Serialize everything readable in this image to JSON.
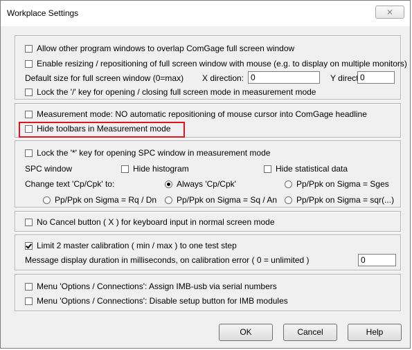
{
  "window": {
    "title": "Workplace Settings",
    "close_glyph": "⨯"
  },
  "group1": {
    "allow_overlap": {
      "label": "Allow other program windows to overlap ComGage full screen window",
      "checked": false
    },
    "enable_resizing": {
      "label": "Enable resizing / repositioning of full screen window with mouse (e.g. to display on multiple monitors)",
      "checked": false
    },
    "default_size_label": "Default size for full screen window (0=max)",
    "x_label": "X direction:",
    "x_value": "0",
    "y_label": "Y direction:",
    "y_value": "0",
    "lock_slash": {
      "label": "Lock the '/' key for opening / closing full screen mode in measurement mode",
      "checked": false
    }
  },
  "group2": {
    "no_reposition": {
      "label": "Measurement mode: NO automatic repositioning of mouse cursor into ComGage headline",
      "checked": false
    },
    "hide_toolbars": {
      "label": "Hide toolbars in Measurement mode",
      "checked": false
    }
  },
  "group3": {
    "lock_star": {
      "label": "Lock the '*' key for opening SPC window in measurement mode",
      "checked": false
    },
    "spc_window_label": "SPC window",
    "hide_histogram": {
      "label": "Hide histogram",
      "checked": false
    },
    "hide_statistical": {
      "label": "Hide statistical data",
      "checked": false
    },
    "change_text_label": "Change text 'Cp/Cpk' to:",
    "radios": [
      {
        "label": "Always 'Cp/Cpk'",
        "checked": true
      },
      {
        "label": "Pp/Ppk on Sigma = Sges",
        "checked": false
      },
      {
        "label": "Pp/Ppk on Sigma = Rq / Dn",
        "checked": false
      },
      {
        "label": "Pp/Ppk on Sigma = Sq / An",
        "checked": false
      },
      {
        "label": "Pp/Ppk on Sigma = sqr(...)",
        "checked": false
      }
    ]
  },
  "group4": {
    "no_cancel": {
      "label": "No Cancel button ( X ) for keyboard input in normal screen mode",
      "checked": false
    }
  },
  "group5": {
    "limit_master": {
      "label": "Limit 2 master calibration ( min / max ) to one test step",
      "checked": true
    },
    "message_duration_label": "Message display duration in milliseconds, on calibration error ( 0 = unlimited )",
    "message_duration_value": "0"
  },
  "group6": {
    "assign_imb": {
      "label": "Menu 'Options / Connections': Assign IMB-usb via serial numbers",
      "checked": false
    },
    "disable_setup": {
      "label": "Menu 'Options / Connections': Disable setup button for IMB modules",
      "checked": false
    }
  },
  "buttons": {
    "ok": "OK",
    "cancel": "Cancel",
    "help": "Help"
  },
  "highlight_color": "#e0141e"
}
